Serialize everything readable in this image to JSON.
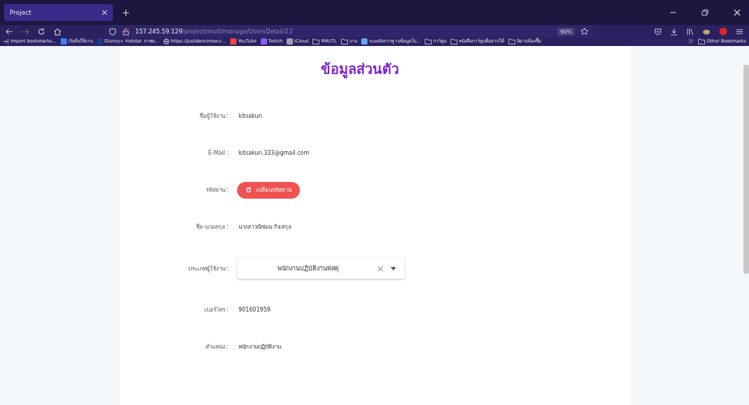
{
  "browser": {
    "tabs": [
      {
        "title": "Project",
        "selected": true
      }
    ],
    "url": {
      "host": "157.245.59.129",
      "path": "/projectrmutl/manage/UsersDetail/23"
    },
    "zoom": "90%",
    "bookmarks": [
      {
        "kind": "import",
        "label": "Import bookmarks..."
      },
      {
        "kind": "site",
        "label": "เริ่มต้นใช้งาน",
        "color": "#3b82f6"
      },
      {
        "kind": "site",
        "label": "Disney+ Hotstar ภาพย...",
        "color": "#1e3a8a"
      },
      {
        "kind": "globe",
        "label": "https://justdancenow.c..."
      },
      {
        "kind": "site",
        "label": "YouTube",
        "color": "#ef4444"
      },
      {
        "kind": "site",
        "label": "Twitch",
        "color": "#8b5cf6"
      },
      {
        "kind": "site",
        "label": "iCloud",
        "color": "#9ca3af"
      },
      {
        "kind": "folder",
        "label": "RMUTL"
      },
      {
        "kind": "folder",
        "label": "งาน"
      },
      {
        "kind": "site",
        "label": "ระบบจัดการฐานข้อมูลโป...",
        "color": "#60a5fa"
      },
      {
        "kind": "folder",
        "label": "การ์ตูน"
      },
      {
        "kind": "folder",
        "label": "หนังสือการ์ตูนที่อยากได้"
      },
      {
        "kind": "folder",
        "label": "นิยายต้องซื้อ"
      }
    ],
    "other_bookmarks": "Other Bookmarks"
  },
  "page": {
    "title": "ข้อมูลส่วนตัว",
    "fields": [
      {
        "kind": "text",
        "label": "ชื่อผู้ใช้งาน :",
        "value": "kitsakun"
      },
      {
        "kind": "text",
        "label": "E-Mail :",
        "value": "kitsakun.333@gmail.com"
      },
      {
        "kind": "button",
        "label": "รหัสผ่าน :",
        "value": "เปลี่ยนรหัสผ่าน"
      },
      {
        "kind": "text",
        "label": "ชื่อ-นามสกุล :",
        "value": "นางสาวณิชมน กิจสกุล"
      },
      {
        "kind": "select",
        "label": "ประเภทผู้ใช้งาน :",
        "value": "พนักงานปฏิบัติงานพัสดุ"
      },
      {
        "kind": "text",
        "label": "เบอร์โทร :",
        "value": "901601959"
      },
      {
        "kind": "text",
        "label": "ตำแหน่ง :",
        "value": "พนักงานปฏิบัติงาน"
      }
    ]
  }
}
